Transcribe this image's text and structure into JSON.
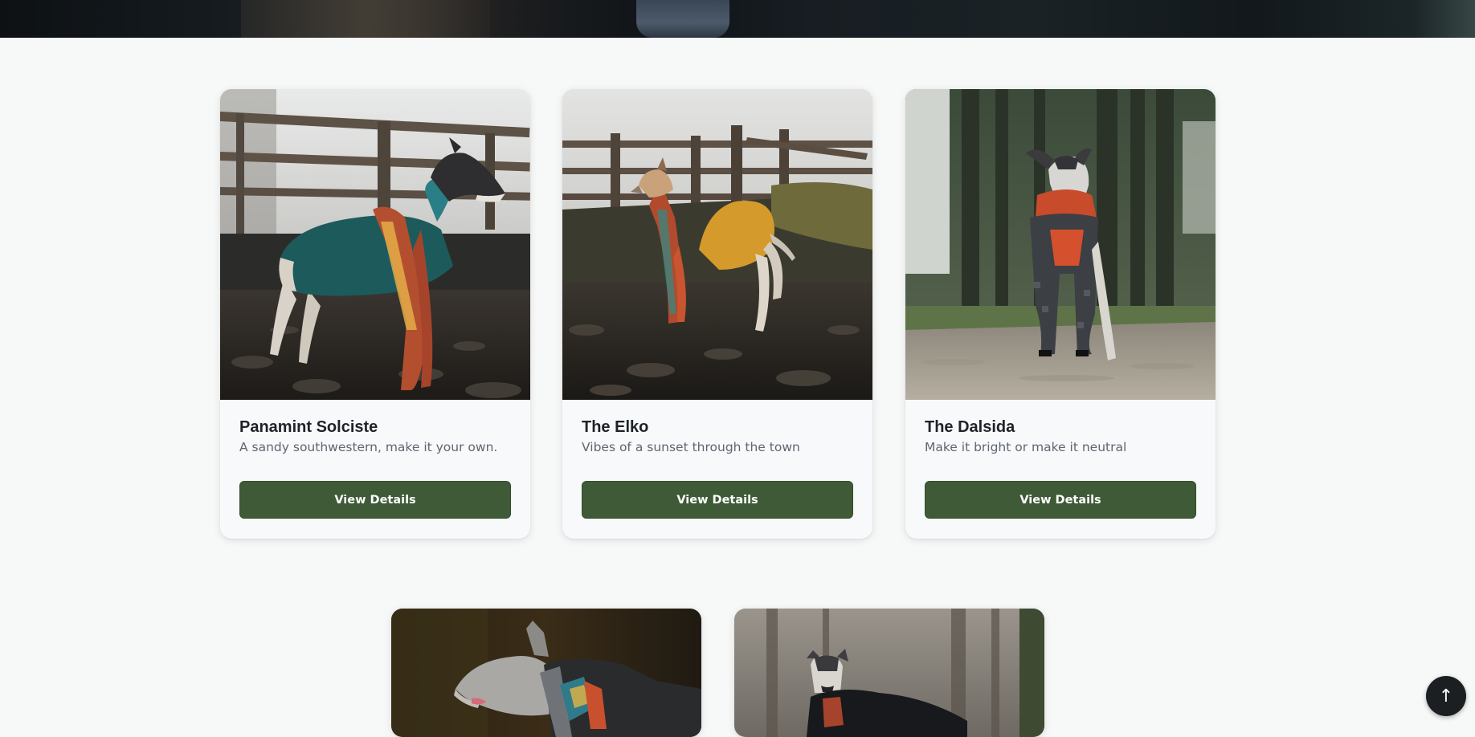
{
  "products": [
    {
      "title": "Panamint Solciste",
      "subtitle": "A sandy southwestern, make it your own.",
      "button_label": "View Details",
      "photo": "whippet-teal-sweater-on-rocks-by-fence"
    },
    {
      "title": "The Elko",
      "subtitle": "Vibes of a sunset through the town",
      "button_label": "View Details",
      "photo": "whippet-mustard-sweater-on-slate-by-fence"
    },
    {
      "title": "The Dalsida",
      "subtitle": "Make it bright or make it neutral",
      "button_label": "View Details",
      "photo": "whippet-grey-orange-sweater-in-forest"
    }
  ],
  "more_products": [
    {
      "photo": "grey-whippet-patterned-collar-profile"
    },
    {
      "photo": "whippet-black-sweater-in-woods"
    }
  ],
  "back_to_top": {
    "icon": "arrow-up-icon",
    "glyph": "↑"
  },
  "colors": {
    "button": "#3f5a36",
    "page_background": "#f7f8f8",
    "back_to_top": "#1c1f22"
  }
}
